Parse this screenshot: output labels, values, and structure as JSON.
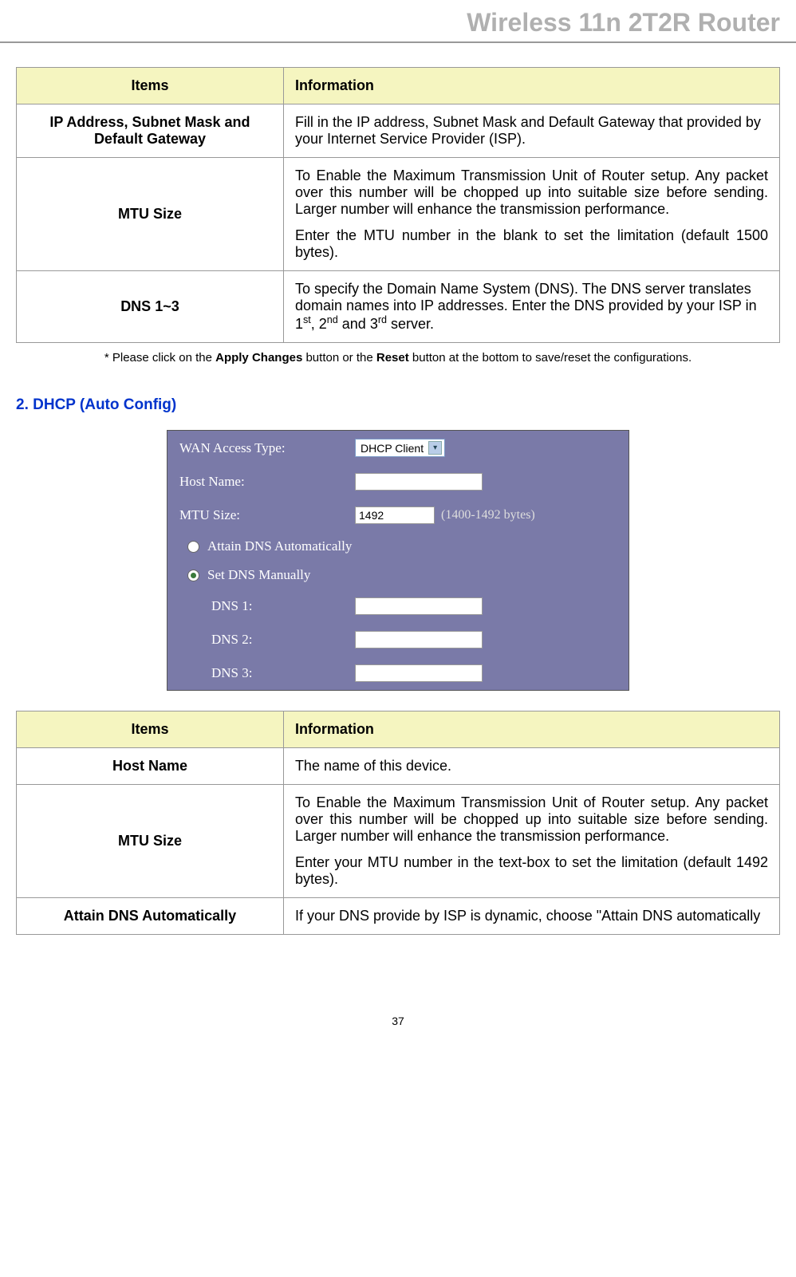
{
  "header": {
    "title": "Wireless 11n 2T2R Router"
  },
  "table1": {
    "headers": [
      "Items",
      "Information"
    ],
    "rows": [
      {
        "item": "IP Address, Subnet Mask and Default Gateway",
        "info": "Fill in the IP address, Subnet Mask and Default Gateway that provided by your Internet Service Provider (ISP)."
      },
      {
        "item": "MTU Size",
        "info_p1": "To Enable the Maximum Transmission Unit of Router setup. Any packet over this number will be chopped up into suitable size before sending. Larger number will enhance the transmission performance.",
        "info_p2": "Enter the MTU number in the blank to set the limitation (default 1500 bytes)."
      },
      {
        "item": "DNS 1~3",
        "info_html": "To specify the Domain Name System (DNS). The DNS server translates domain names into IP addresses. Enter the DNS provided by your ISP in 1st, 2nd and 3rd server."
      }
    ]
  },
  "footnote": {
    "prefix": "* Please click on the ",
    "bold1": "Apply Changes",
    "mid": " button or the ",
    "bold2": "Reset",
    "suffix": " button at the bottom to save/reset the configurations."
  },
  "section2": {
    "heading": "2. DHCP (Auto Config)"
  },
  "screenshot": {
    "wan_label": "WAN Access Type:",
    "wan_value": "DHCP Client",
    "host_label": "Host Name:",
    "host_value": "",
    "mtu_label": "MTU Size:",
    "mtu_value": "1492",
    "mtu_hint": "(1400-1492 bytes)",
    "radio1": "Attain DNS Automatically",
    "radio2": "Set DNS Manually",
    "dns1_label": "DNS 1:",
    "dns2_label": "DNS 2:",
    "dns3_label": "DNS 3:"
  },
  "table2": {
    "headers": [
      "Items",
      "Information"
    ],
    "rows": [
      {
        "item": "Host Name",
        "info": "The name of this device."
      },
      {
        "item": "MTU Size",
        "info_p1": "To Enable the Maximum Transmission Unit of Router setup. Any packet over this number will be chopped up into suitable size before sending. Larger number will enhance the transmission performance.",
        "info_p2": "Enter your MTU number in the text-box to set the limitation (default 1492 bytes)."
      },
      {
        "item": "Attain DNS Automatically",
        "info": "If your DNS provide by ISP is dynamic, choose \"Attain DNS automatically"
      }
    ]
  },
  "page_number": "37"
}
